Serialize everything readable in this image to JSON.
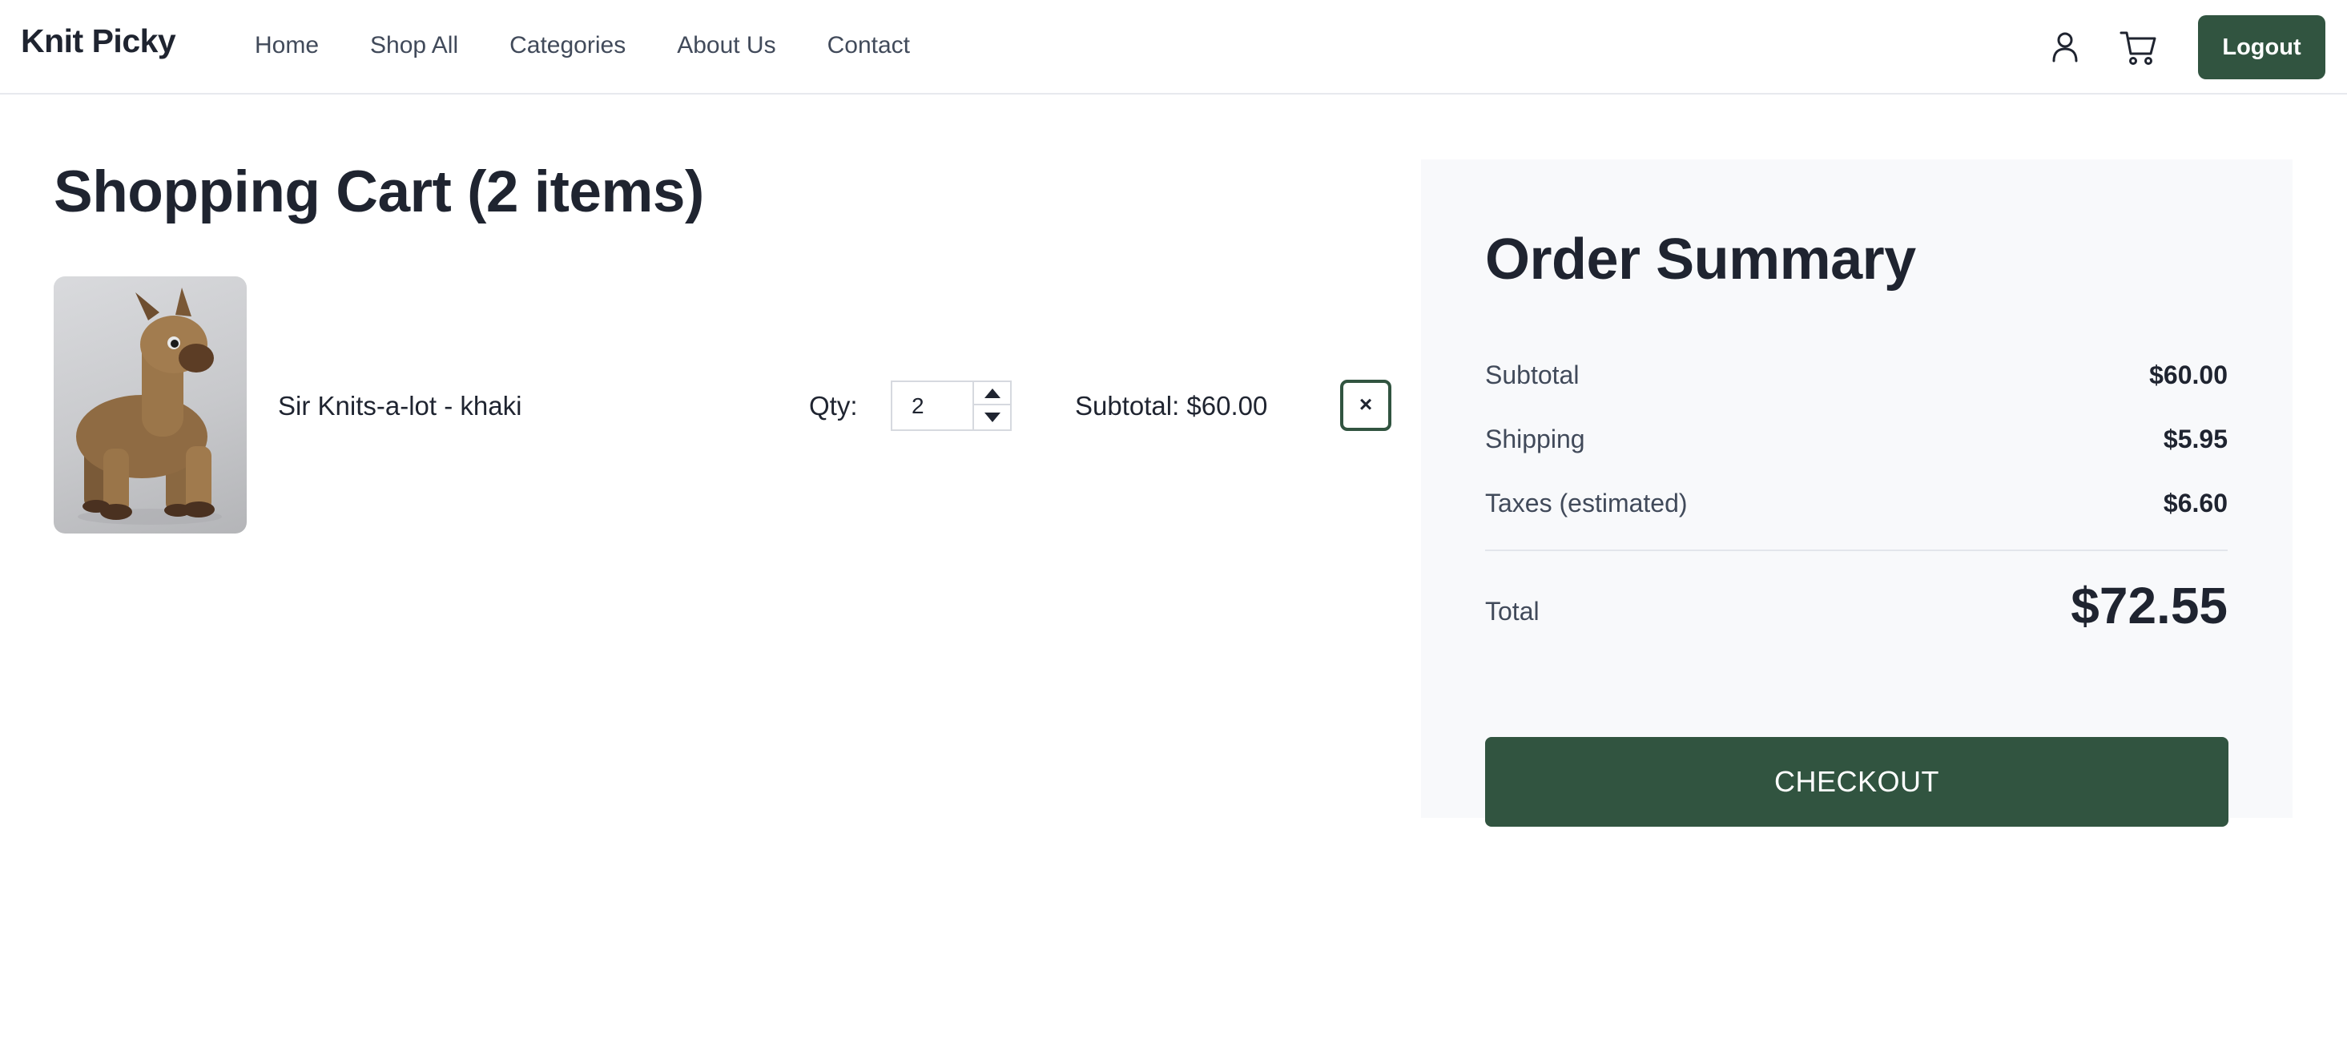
{
  "header": {
    "brand": "Knit Picky",
    "nav": [
      {
        "label": "Home"
      },
      {
        "label": "Shop All"
      },
      {
        "label": "Categories"
      },
      {
        "label": "About Us"
      },
      {
        "label": "Contact"
      }
    ],
    "icons": {
      "account": "user-icon",
      "cart": "cart-icon"
    },
    "logout_label": "Logout"
  },
  "cart": {
    "title": "Shopping Cart (2 items)",
    "items": [
      {
        "name": "Sir Knits-a-lot - khaki",
        "image": "plush-alpaca-toy",
        "qty_label": "Qty:",
        "qty": "2",
        "subtotal_text": "Subtotal: $60.00",
        "remove_symbol": "×"
      }
    ]
  },
  "summary": {
    "title": "Order Summary",
    "subtotal": {
      "label": "Subtotal",
      "value": "$60.00"
    },
    "shipping": {
      "label": "Shipping",
      "value": "$5.95"
    },
    "taxes": {
      "label": "Taxes (estimated)",
      "value": "$6.60"
    },
    "total": {
      "label": "Total",
      "value": "$72.55"
    },
    "checkout_label": "CHECKOUT"
  },
  "colors": {
    "accent": "#315440",
    "summary_bg": "#f8f9fb",
    "text": "#1f2430",
    "muted_text": "#414a5a"
  }
}
